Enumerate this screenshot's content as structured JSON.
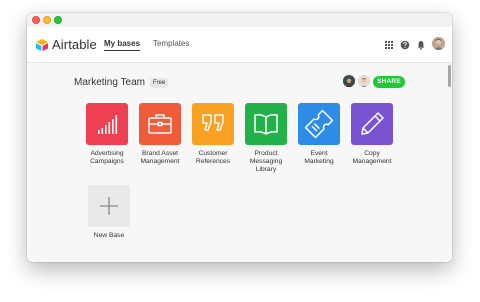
{
  "app": {
    "brand": "Airtable"
  },
  "nav": {
    "tabs": [
      {
        "label": "My bases",
        "active": true
      },
      {
        "label": "Templates",
        "active": false
      }
    ]
  },
  "header_icons": [
    "apps-grid-icon",
    "help-icon",
    "bell-icon",
    "user-avatar"
  ],
  "workspace": {
    "name": "Marketing Team",
    "plan": "Free",
    "share_label": "SHARE"
  },
  "bases": [
    {
      "name": "Advertising Campaigns",
      "color": "#ef3f52",
      "icon": "bar-chart-icon"
    },
    {
      "name": "Brand Asset Management",
      "color": "#f15b3a",
      "icon": "briefcase-icon"
    },
    {
      "name": "Customer References",
      "color": "#f8a123",
      "icon": "quote-icon"
    },
    {
      "name": "Product Messaging Library",
      "color": "#22b249",
      "icon": "book-icon"
    },
    {
      "name": "Event Marketing",
      "color": "#2d8de6",
      "icon": "ticket-icon"
    },
    {
      "name": "Copy Management",
      "color": "#7953d2",
      "icon": "pencil-icon"
    }
  ],
  "new_base": {
    "label": "New Base",
    "icon": "plus-icon"
  }
}
